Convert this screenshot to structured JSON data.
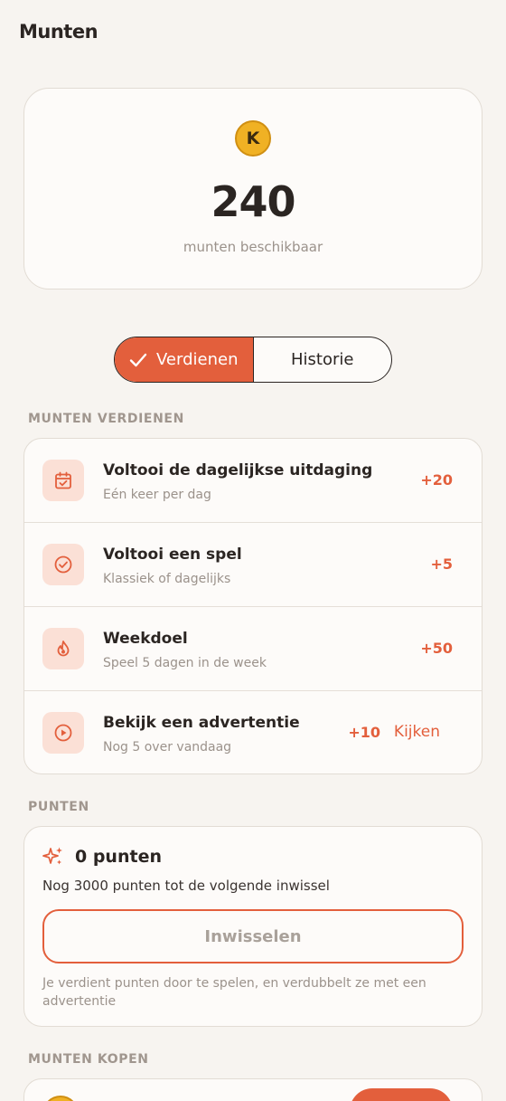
{
  "header": {
    "title": "Munten"
  },
  "balance": {
    "coin_letter": "K",
    "amount": "240",
    "label": "munten beschikbaar"
  },
  "tabs": {
    "earn_label": "Verdienen",
    "history_label": "Historie",
    "active": "earn"
  },
  "earn_section": {
    "title": "MUNTEN VERDIENEN",
    "items": [
      {
        "icon": "calendar-check-icon",
        "title": "Voltooi de dagelijkse uitdaging",
        "subtitle": "Eén keer per dag",
        "reward": "+20"
      },
      {
        "icon": "check-circle-icon",
        "title": "Voltooi een spel",
        "subtitle": "Klassiek of dagelijks",
        "reward": "+5"
      },
      {
        "icon": "flame-icon",
        "title": "Weekdoel",
        "subtitle": "Speel 5 dagen in de week",
        "reward": "+50"
      },
      {
        "icon": "play-circle-icon",
        "title": "Bekijk een advertentie",
        "subtitle": "Nog 5 over vandaag",
        "reward": "+10",
        "action": "Kijken"
      }
    ]
  },
  "points_section": {
    "title": "PUNTEN",
    "points_label": "0 punten",
    "description": "Nog 3000 punten tot de volgende inwissel",
    "redeem_label": "Inwisselen",
    "note": "Je verdient punten door te spelen, en verdubbelt ze met een advertentie"
  },
  "buy_section": {
    "title": "MUNTEN KOPEN",
    "coin_letter": "K"
  },
  "colors": {
    "accent": "#e35f3c",
    "background": "#f7f4f0",
    "coin": "#f0b124"
  }
}
